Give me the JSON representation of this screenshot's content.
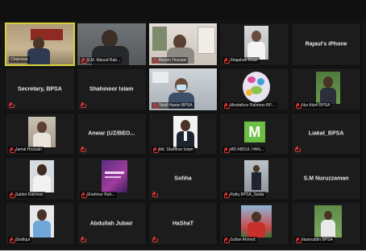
{
  "participants": [
    {
      "name": "Chairman",
      "kind": "video",
      "active": true
    },
    {
      "name": "S.M. Masud Rab...",
      "kind": "video"
    },
    {
      "name": "Alamin Hossain",
      "kind": "video"
    },
    {
      "name": "Shajahan Khan",
      "kind": "video"
    },
    {
      "name": "Rajaul's iPhone",
      "kind": "name"
    },
    {
      "name": "Secretary, BPSA",
      "kind": "name"
    },
    {
      "name": "Shahinoor Islam",
      "kind": "name"
    },
    {
      "name": "Tanjil Hasan BPSA",
      "kind": "video"
    },
    {
      "name": "Mostafizur Rahman BPSA",
      "kind": "photo"
    },
    {
      "name": "Nur Alam BPSA",
      "kind": "photo"
    },
    {
      "name": "Jamal Hossain",
      "kind": "photo"
    },
    {
      "name": "Anwar (UZ/BEO...",
      "kind": "name"
    },
    {
      "name": "Md. Shahinur Islam",
      "kind": "photo"
    },
    {
      "name": "MD ABDUL HAN...",
      "kind": "avatar",
      "initial": "M"
    },
    {
      "name": "Liakat_BPSA",
      "kind": "name"
    },
    {
      "name": "Sabbir Rahman",
      "kind": "photo"
    },
    {
      "name": "Shahinur Rah...",
      "kind": "photo"
    },
    {
      "name": "Sofiha",
      "kind": "name"
    },
    {
      "name": "Rafiq BPSA_Sadar",
      "kind": "photo"
    },
    {
      "name": "S.M Nuruzzaman",
      "kind": "name"
    },
    {
      "name": "Shafiqul",
      "kind": "photo"
    },
    {
      "name": "Abdullah Jubair",
      "kind": "name"
    },
    {
      "name": "HaShaT",
      "kind": "name"
    },
    {
      "name": "Sultan Ahmed",
      "kind": "photo"
    },
    {
      "name": "Nasiruddin BPSA",
      "kind": "photo"
    }
  ]
}
